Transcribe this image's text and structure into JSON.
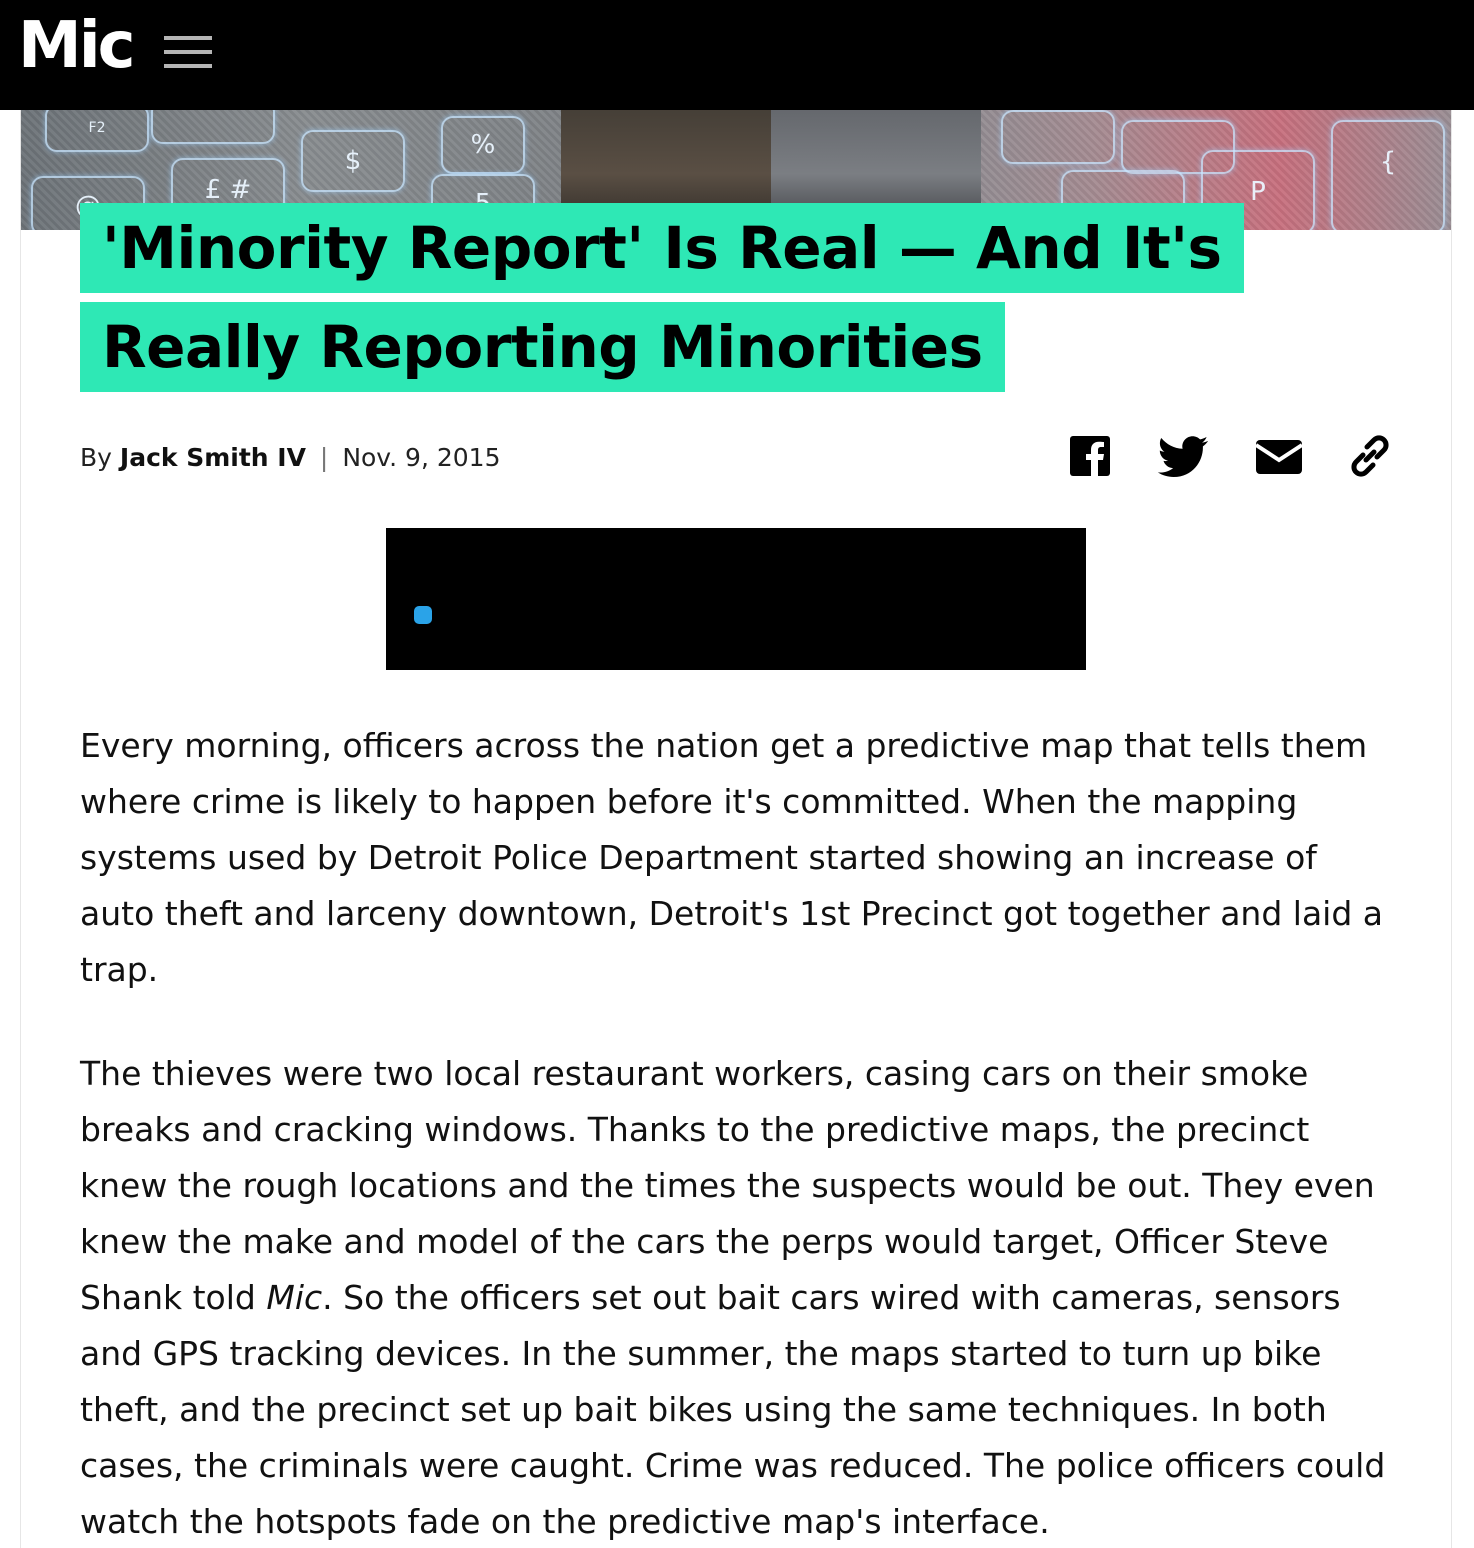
{
  "header": {
    "logo": "Mic",
    "menu_icon": "hamburger-menu-icon"
  },
  "hero": {
    "keys": [
      "F2",
      "%",
      "$",
      "£ #",
      "5",
      "P",
      "@",
      "{"
    ]
  },
  "article": {
    "headline_line1": "'Minority Report' Is Real — And It's",
    "headline_line2": "Really Reporting Minorities",
    "byline_prefix": "By",
    "author": "Jack Smith IV",
    "separator": "|",
    "date": "Nov. 9, 2015",
    "paragraph1": "Every morning, officers across the nation get a predictive map that tells them where crime is likely to happen before it's committed. When the mapping systems used by Detroit Police Department started showing an increase of auto theft and larceny downtown, Detroit's 1st Precinct got together and laid a trap.",
    "paragraph2_a": "The thieves were two local restaurant workers, casing cars on their smoke breaks and cracking windows. Thanks to the predictive maps, the precinct knew the rough locations and the times the suspects would be out. They even knew the make and model of the cars the perps would target, Officer Steve Shank told ",
    "paragraph2_em": "Mic",
    "paragraph2_b": ". So the officers set out bait cars wired with cameras, sensors and GPS tracking devices. In the summer, the maps started to turn up bike theft, and the precinct set up bait bikes using the same techniques. In both cases, the criminals were caught. Crime was reduced. The police officers could watch the hotspots fade on the predictive map's interface."
  },
  "share": {
    "icons": [
      "facebook-icon",
      "twitter-icon",
      "email-icon",
      "link-icon"
    ]
  },
  "colors": {
    "header_bg": "#000000",
    "headline_highlight": "#2ee8b5",
    "video_bg": "#000000",
    "video_indicator": "#2aa3e8"
  }
}
